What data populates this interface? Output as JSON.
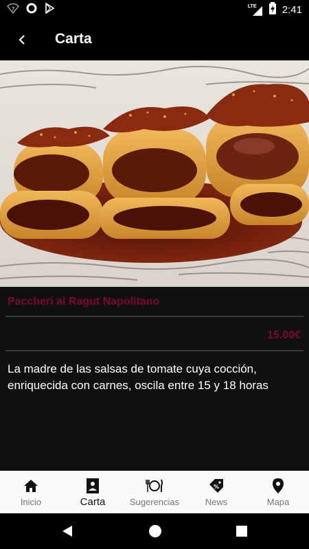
{
  "status_bar": {
    "time": "2:41",
    "network_label": "LTE",
    "icons": [
      "wifi-question-icon",
      "circle-notification-icon",
      "play-store-icon",
      "lte-signal-icon",
      "battery-charging-icon"
    ]
  },
  "app_bar": {
    "title": "Carta",
    "back_icon": "chevron-left-icon"
  },
  "dish": {
    "name": "Paccheri al Ragut Napolitano",
    "price": "15.00€",
    "description": "La madre de las salsas de tomate cuya cocción, enriquecida con carnes, oscila entre 15 y 18 horas",
    "image": "pasta-photo"
  },
  "bottom_nav": {
    "items": [
      {
        "label": "Inicio",
        "icon": "home-icon"
      },
      {
        "label": "Carta",
        "icon": "menu-card-icon",
        "active": true
      },
      {
        "label": "Sugerencias",
        "icon": "plate-cutlery-icon"
      },
      {
        "label": "News",
        "icon": "tag-percent-icon"
      },
      {
        "label": "Mapa",
        "icon": "map-pin-icon"
      }
    ]
  },
  "colors": {
    "accent": "#7a0a2a",
    "background": "#111111",
    "nav_background": "#fafafa"
  }
}
